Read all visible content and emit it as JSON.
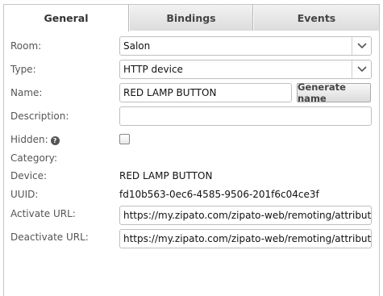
{
  "tabs": [
    {
      "label": "General",
      "active": true
    },
    {
      "label": "Bindings",
      "active": false
    },
    {
      "label": "Events",
      "active": false
    }
  ],
  "form": {
    "room_label": "Room:",
    "room_value": "Salon",
    "type_label": "Type:",
    "type_value": "HTTP device",
    "name_label": "Name:",
    "name_value": "RED LAMP BUTTON",
    "generate_name_button": "Generate name",
    "description_label": "Description:",
    "description_value": "",
    "hidden_label": "Hidden:",
    "hidden_checked": false,
    "help_glyph": "?",
    "category_label": "Category:",
    "device_label": "Device:",
    "device_value": "RED LAMP BUTTON",
    "uuid_label": "UUID:",
    "uuid_value": "fd10b563-0ec6-4585-9506-201f6c04ce3f",
    "activate_url_label": "Activate URL:",
    "activate_url_value": "https://my.zipato.com/zipato-web/remoting/attribute/set?",
    "deactivate_url_label": "Deactivate URL:",
    "deactivate_url_value": "https://my.zipato.com/zipato-web/remoting/attribute/set?"
  },
  "icons": {
    "dropdown": "chevron-down-icon",
    "help": "help-icon"
  }
}
